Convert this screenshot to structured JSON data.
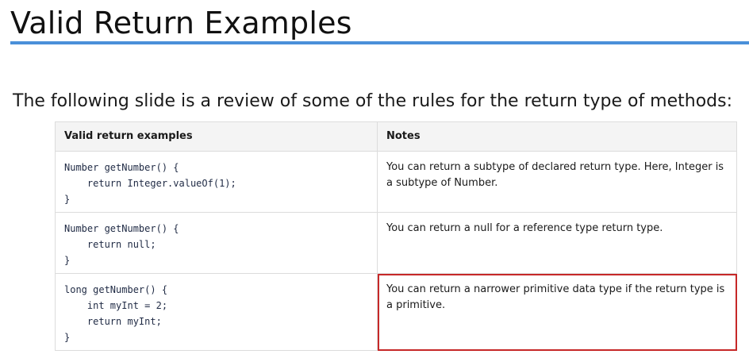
{
  "slide": {
    "title": "Valid Return Examples",
    "intro": "The following slide is a review of some of the rules for the return type of methods:",
    "accent_color": "#4a90d9",
    "highlight_color": "#c62828"
  },
  "table": {
    "headers": [
      "Valid return examples",
      "Notes"
    ],
    "rows": [
      {
        "code": "Number getNumber() {\n    return Integer.valueOf(1);\n}",
        "note": "You can return a subtype of declared return type. Here, Integer is a subtype of Number.",
        "highlighted": false
      },
      {
        "code": "Number getNumber() {\n    return null;\n}",
        "note": "You can return a null for a reference type return type.",
        "highlighted": false
      },
      {
        "code": "long getNumber() {\n    int myInt = 2;\n    return myInt;\n}",
        "note": "You can return a narrower primitive data type if the return type is a primitive.",
        "highlighted": true
      }
    ]
  }
}
